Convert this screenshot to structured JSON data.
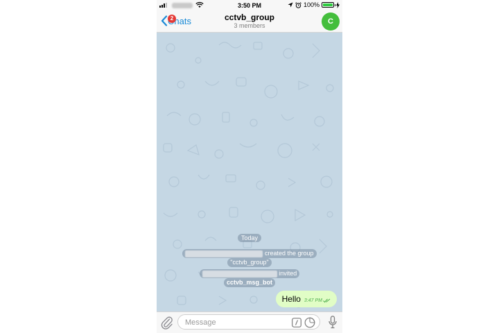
{
  "status_bar": {
    "time": "3:50 PM",
    "battery_percent": "100%",
    "battery_level": 1.0
  },
  "header": {
    "back_label": "Chats",
    "unread_badge": "2",
    "title": "cctvb_group",
    "subtitle": "3 members",
    "avatar_letter": "C"
  },
  "chat": {
    "date_label": "Today",
    "service_messages": [
      {
        "action": "created the group",
        "detail": "\"cctvb_group\""
      },
      {
        "action": "invited",
        "detail": "cctvb_msg_bot"
      }
    ],
    "messages": [
      {
        "text": "Hello",
        "time": "3:47 PM",
        "outgoing": true,
        "read": true
      }
    ]
  },
  "input": {
    "placeholder": "Message",
    "value": ""
  },
  "colors": {
    "accent": "#1a8ad6",
    "chat_background": "#c5d7e4",
    "outgoing_bubble": "#e1fdc6",
    "avatar": "#44be3c",
    "badge": "#e53935"
  },
  "icons": [
    "signal-icon",
    "wifi-icon",
    "location-icon",
    "alarm-icon",
    "battery-icon",
    "charging-icon",
    "back-chevron-icon",
    "attach-icon",
    "command-icon",
    "sticker-icon",
    "microphone-icon",
    "double-check-icon"
  ]
}
